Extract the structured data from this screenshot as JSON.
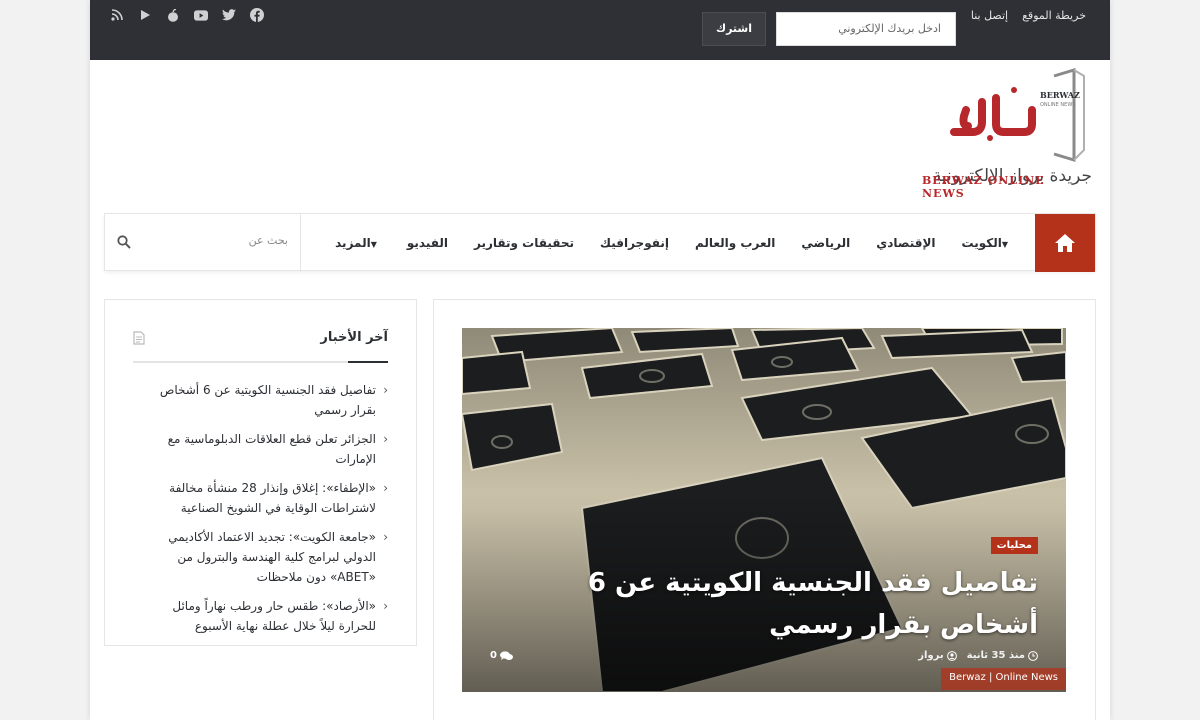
{
  "topbar": {
    "links": [
      "خريطة الموقع",
      "إتصل بنا"
    ],
    "email_placeholder": "ادخل بريدك الإلكتروني",
    "subscribe_label": "اشترك",
    "socials": [
      "facebook-icon",
      "twitter-icon",
      "youtube-icon",
      "apple-icon",
      "play-icon",
      "rss-icon"
    ]
  },
  "logo": {
    "arabic": "جريدة برواز الإلكترونية",
    "english": "BERWAZ ONLINE NEWS"
  },
  "nav": {
    "items": [
      {
        "label": "الكويت",
        "dropdown": true
      },
      {
        "label": "الإقتصادي",
        "dropdown": false
      },
      {
        "label": "الرياضي",
        "dropdown": false
      },
      {
        "label": "العرب والعالم",
        "dropdown": false
      },
      {
        "label": "إنفوجرافيك",
        "dropdown": false
      },
      {
        "label": "تحقيقات وتقارير",
        "dropdown": false
      },
      {
        "label": "الفيديو",
        "dropdown": false
      },
      {
        "label": "المزيد",
        "dropdown": true
      }
    ],
    "search_placeholder": "بحث عن"
  },
  "widget": {
    "title": "آخر الأخبار",
    "items": [
      "تفاصيل فقد الجنسية الكويتية عن 6 أشخاص بقرار رسمي",
      "الجزائر تعلن قطع العلاقات الدبلوماسية مع الإمارات",
      "«الإطفاء»: إغلاق وإنذار 28 منشأة مخالفة لاشتراطات الوقاية في الشويخ الصناعية",
      "«جامعة الكويت»: تجديد الاعتماد الأكاديمي الدولي لبرامج كلية الهندسة والبترول من «ABET» دون ملاحظات",
      "«الأرصاد»: طقس حار ورطب نهاراً ومائل للحرارة ليلاً خلال عطلة نهاية الأسبوع"
    ]
  },
  "featured": {
    "category": "محليات",
    "title": "تفاصيل فقد الجنسية الكويتية عن 6 أشخاص بقرار رسمي",
    "author": "برواز",
    "time": "منذ 35 ثانية",
    "comments": "0",
    "watermark": "Berwaz | Online News"
  },
  "colors": {
    "accent": "#b4321a",
    "topbar": "#2e3035"
  }
}
